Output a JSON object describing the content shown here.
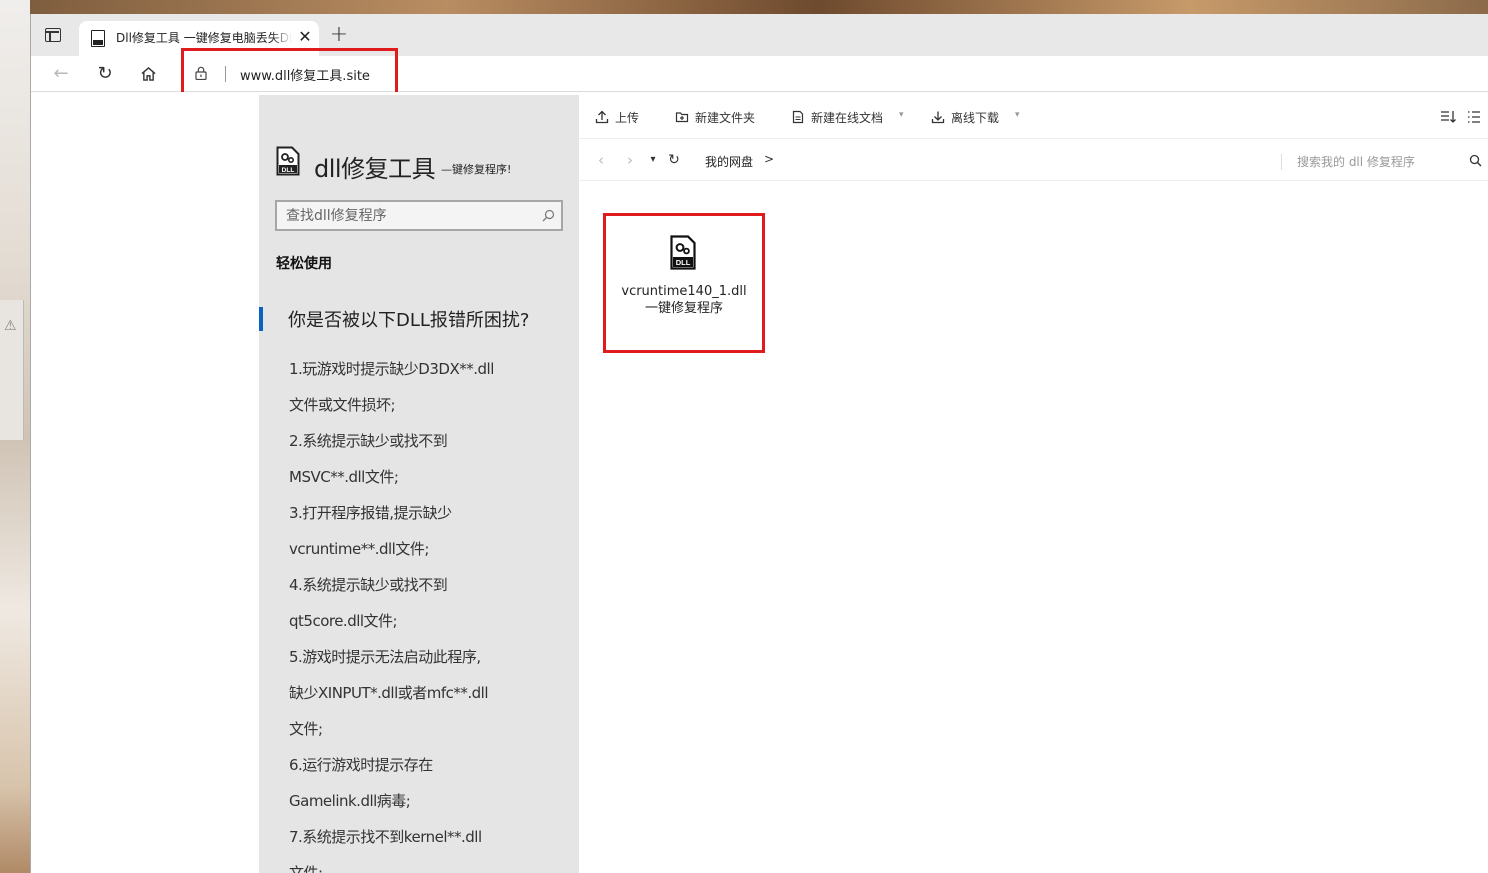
{
  "browser": {
    "tab": {
      "title": "Dll修复工具 一键修复电脑丢失DLL文件",
      "close_glyph": "✕",
      "favicon": "dll-file-icon"
    },
    "new_tab_glyph": "+",
    "nav": {
      "back_glyph": "←",
      "refresh_glyph": "↻",
      "home_icon": "home-icon"
    },
    "address": {
      "url": "www.dll修复工具.site",
      "lock_icon": "lock-icon"
    },
    "highlight_color": "#e01b1b"
  },
  "sidebar": {
    "title": "dll修复工具",
    "tagline": "—键修复程序!",
    "search_placeholder": "查找dll修复程序",
    "section_label": "轻松使用",
    "question": "你是否被以下DLL报错所困扰?",
    "accent_color": "#0b63c1",
    "items": [
      "1.玩游戏时提示缺少D3DX**.dll",
      "文件或文件损坏;",
      "2.系统提示缺少或找不到",
      "MSVC**.dll文件;",
      "3.打开程序报错,提示缺少",
      "vcruntime**.dll文件;",
      "4.系统提示缺少或找不到",
      "qt5core.dll文件;",
      "5.游戏时提示无法启动此程序,",
      "缺少XINPUT*.dll或者mfc**.dll",
      "文件;",
      "6.运行游戏时提示存在",
      "Gamelink.dll病毒;",
      "7.系统提示找不到kernel**.dll",
      "文件;"
    ]
  },
  "file_manager": {
    "toolbar": {
      "upload": "上传",
      "new_folder": "新建文件夹",
      "new_doc": "新建在线文档",
      "offline_download": "离线下载",
      "caret_glyph": "▾"
    },
    "nav": {
      "back_glyph": "‹",
      "forward_glyph": "›",
      "dropdown_glyph": "▾",
      "refresh_glyph": "↻",
      "breadcrumb": "我的网盘",
      "crumb_sep": ">",
      "search_placeholder": "搜索我的 dll 修复程序"
    },
    "files": [
      {
        "name_line1": "vcruntime140_1.dll",
        "name_line2": "一键修复程序",
        "icon": "dll-file-icon"
      }
    ]
  }
}
